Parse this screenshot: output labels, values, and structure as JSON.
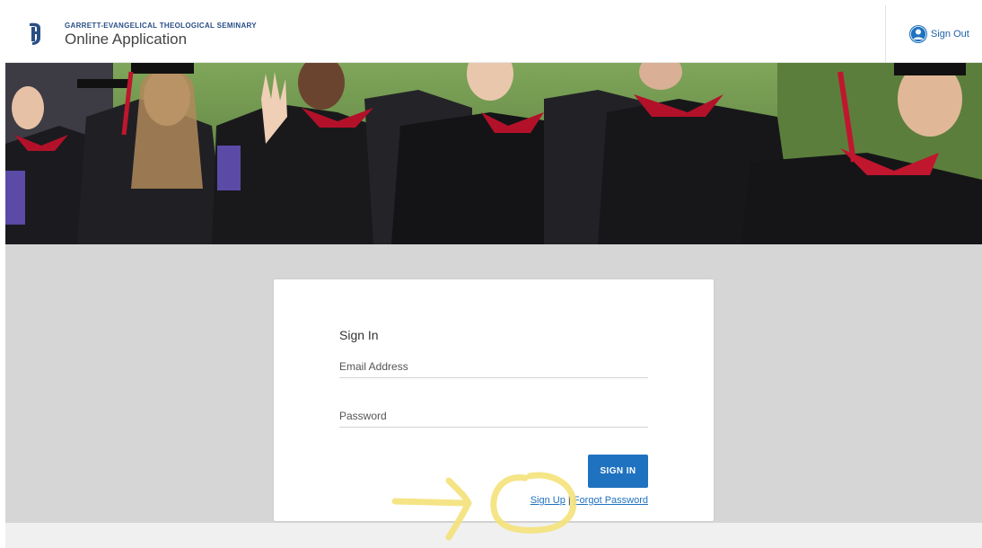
{
  "header": {
    "org_name": "GARRETT-EVANGELICAL THEOLOGICAL SEMINARY",
    "app_title": "Online Application",
    "sign_out_label": "Sign Out",
    "icons": [
      "seminary-logo-icon",
      "user-circle-icon"
    ]
  },
  "signin": {
    "title": "Sign In",
    "email_placeholder": "Email Address",
    "email_value": "",
    "password_placeholder": "Password",
    "password_value": "",
    "submit_label": "SIGN IN",
    "signup_link": "Sign Up",
    "separator": "|",
    "forgot_link": "Forgot Password"
  },
  "colors": {
    "brand_blue": "#1f72bf",
    "brand_dark_blue": "#2a4f86",
    "content_bg": "#d6d6d6",
    "highlight_yellow": "#f4e27a"
  }
}
